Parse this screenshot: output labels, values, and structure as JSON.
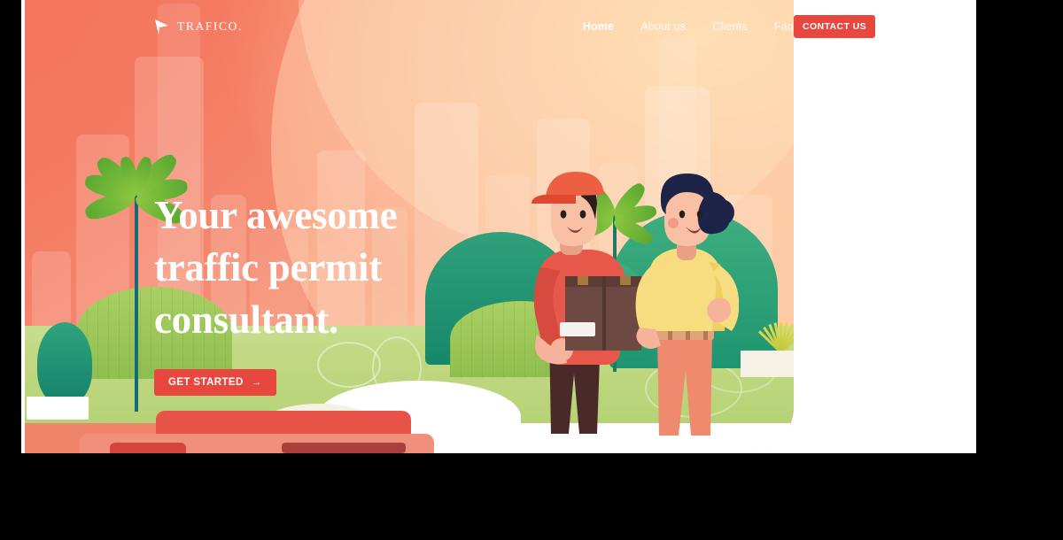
{
  "site": {
    "brand": "TRAFICO.",
    "brand_icon": "arrow-logo-icon"
  },
  "nav": {
    "items": [
      {
        "label": "Home",
        "active": true
      },
      {
        "label": "About us",
        "active": false
      },
      {
        "label": "Clients",
        "active": false
      },
      {
        "label": "Faq",
        "active": false
      }
    ],
    "contact_label": "CONTACT US"
  },
  "hero": {
    "headline_line1": "Your awesome",
    "headline_line2": "traffic permit",
    "headline_line3": "consultant.",
    "cta_label": "GET STARTED",
    "cta_arrow": "→"
  },
  "colors": {
    "accent_red": "#e8473f",
    "coral_start": "#f4755f",
    "peach_end": "#fdd9ab",
    "grass_light": "#c3da86",
    "bush_green": "#1e9570",
    "palm_frond": "#8cc63f",
    "palm_trunk": "#15697a",
    "page_background": "#ffffff",
    "chrome_background": "#000000"
  },
  "illustration": {
    "scene": "two-people-handing-box-city-park",
    "man": {
      "cap": "red-cap",
      "shirt": "red-tshirt",
      "pants": "dark-brown-pants",
      "holding": "cardboard-box"
    },
    "woman": {
      "hair": "dark-bun",
      "shirt": "yellow-tshirt",
      "pants": "coral-pants"
    },
    "props": [
      "palm-tree-left",
      "palm-tree-center",
      "potted-plant",
      "agave",
      "bushes",
      "delivery-van",
      "city-skyline"
    ]
  }
}
